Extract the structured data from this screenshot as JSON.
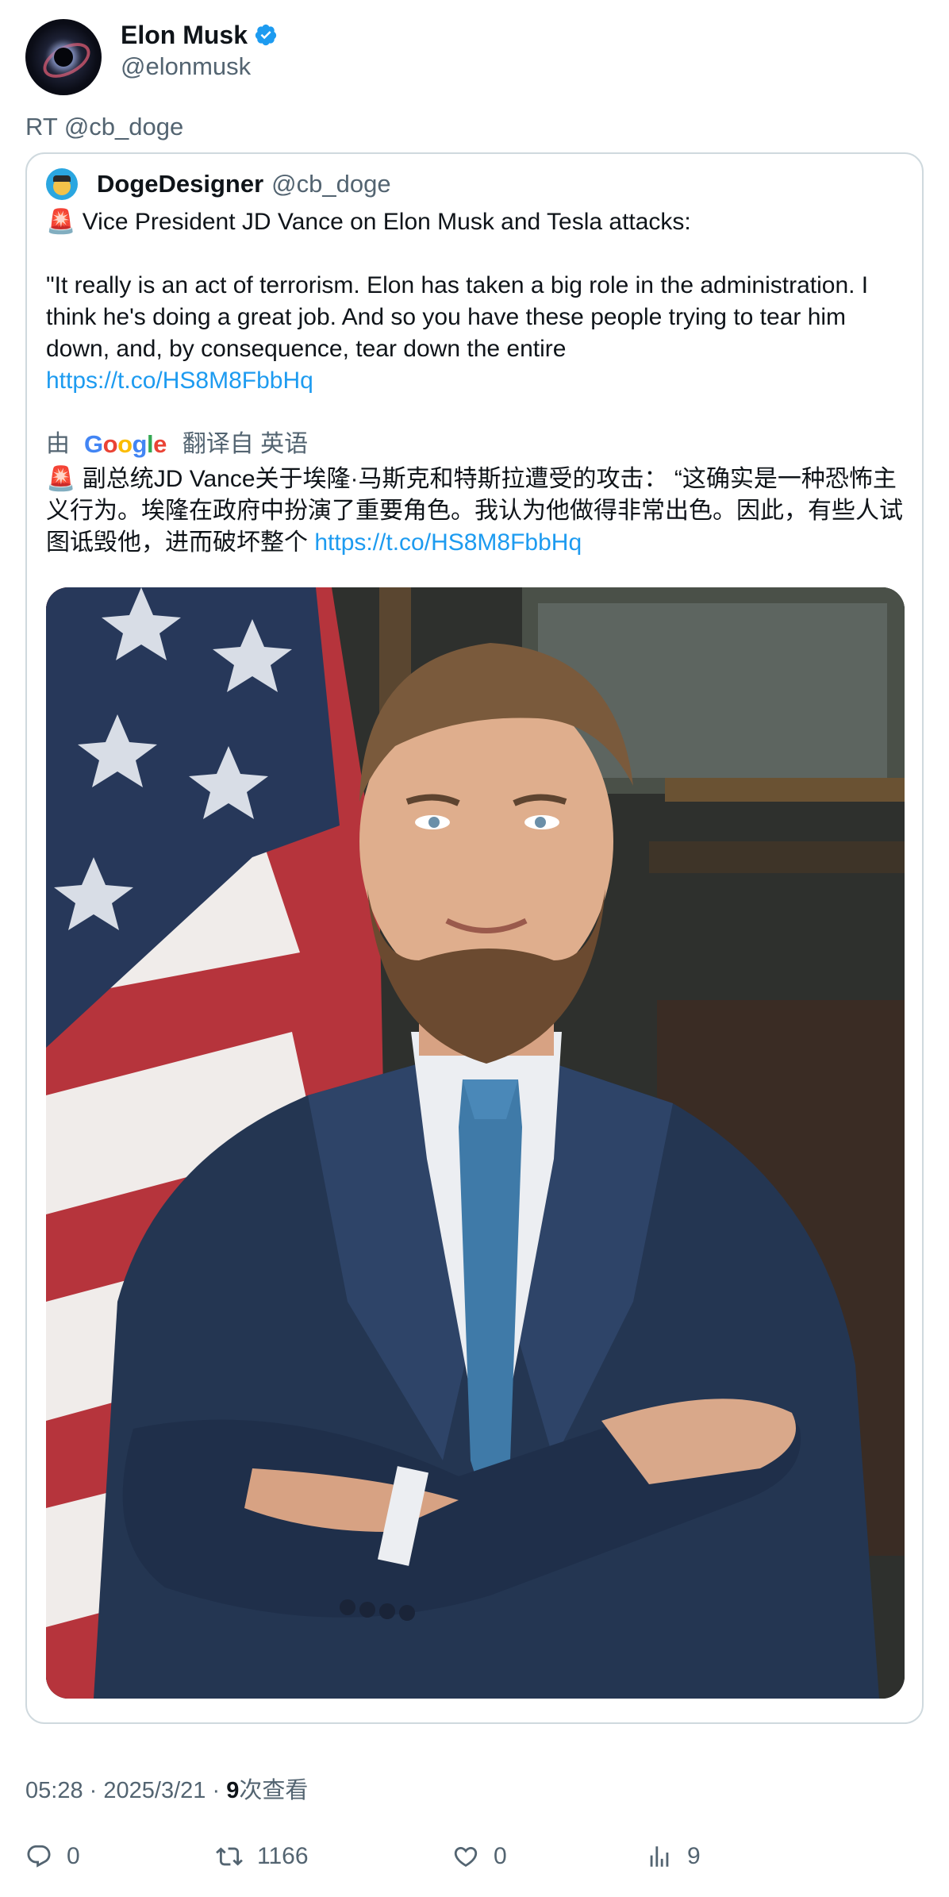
{
  "tweet": {
    "author": {
      "display_name": "Elon Musk",
      "handle": "@elonmusk",
      "verified": true,
      "verified_color": "#1d9bf0"
    },
    "retweet_line": "RT @cb_doge",
    "quoted": {
      "display_name": "DogeDesigner",
      "handle": "@cb_doge",
      "text_line1": "🚨 Vice President JD Vance on Elon Musk and Tesla attacks:",
      "text_para2": "\"It really is an act of terrorism. Elon has taken a big role in the administration. I think he's doing a great job. And so you have these people trying to tear him down, and, by consequence, tear down the entire",
      "link": "https://t.co/HS8M8FbbHq",
      "translation": {
        "prefix": "由",
        "provider": "Google",
        "suffix": "翻译自 英语",
        "text": "🚨 副总统JD Vance关于埃隆·马斯克和特斯拉遭受的攻击： “这确实是一种恐怖主义行为。埃隆在政府中扮演了重要角色。我认为他做得非常出色。因此，有些人试图诋毁他，进而破坏整个",
        "link": "https://t.co/HS8M8FbbHq"
      },
      "image_subject": "portrait-photo"
    },
    "meta": {
      "time": "05:28",
      "separator": "·",
      "date": "2025/3/21",
      "views_count": "9",
      "views_label": "次查看"
    },
    "actions": {
      "replies": "0",
      "retweets": "1166",
      "likes": "0",
      "views": "9"
    }
  },
  "colors": {
    "text_primary": "#0f1419",
    "text_secondary": "#536471",
    "link": "#1d9bf0",
    "border": "#cfd9de"
  }
}
